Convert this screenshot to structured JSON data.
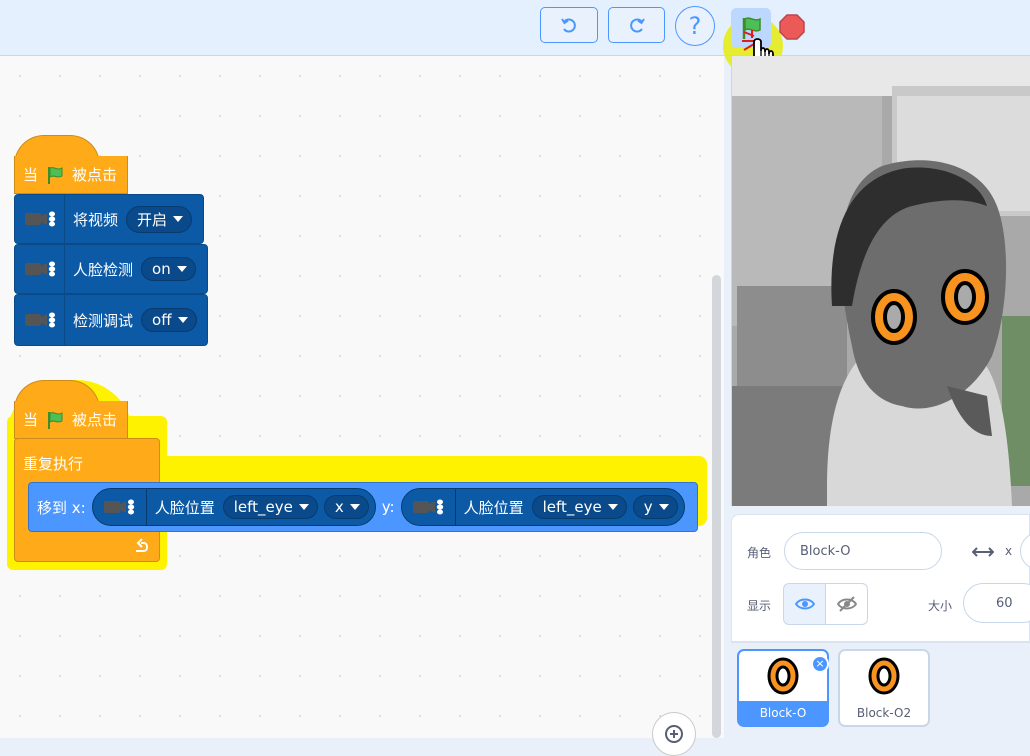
{
  "toolbar": {
    "undo_icon": "undo-icon",
    "redo_icon": "redo-icon",
    "help_label": "?",
    "green_flag_icon": "green-flag-icon",
    "stop_icon": "stop-icon"
  },
  "scripts": {
    "script1": {
      "hat": {
        "when": "当",
        "clicked": "被点击"
      },
      "block1": {
        "label": "将视频",
        "value": "开启"
      },
      "block2": {
        "label": "人脸检测",
        "value": "on"
      },
      "block3": {
        "label": "检测调试",
        "value": "off"
      }
    },
    "script2": {
      "hat": {
        "when": "当",
        "clicked": "被点击"
      },
      "forever_label": "重复执行",
      "goto": {
        "prefix": "移到 x:",
        "y_label": "y:",
        "reporter1": {
          "label": "人脸位置",
          "part": "left_eye",
          "axis": "x"
        },
        "reporter2": {
          "label": "人脸位置",
          "part": "left_eye",
          "axis": "y"
        }
      }
    }
  },
  "sprite_info": {
    "sprite_label": "角色",
    "sprite_name": "Block-O",
    "x_label": "x",
    "show_label": "显示",
    "size_label": "大小",
    "size_value": "60"
  },
  "sprites": [
    {
      "name": "Block-O",
      "selected": true
    },
    {
      "name": "Block-O2",
      "selected": false
    }
  ],
  "colors": {
    "events": "#ffab19",
    "extension": "#0c5aa6",
    "motion": "#4c97ff",
    "accent": "#4c97ff"
  }
}
